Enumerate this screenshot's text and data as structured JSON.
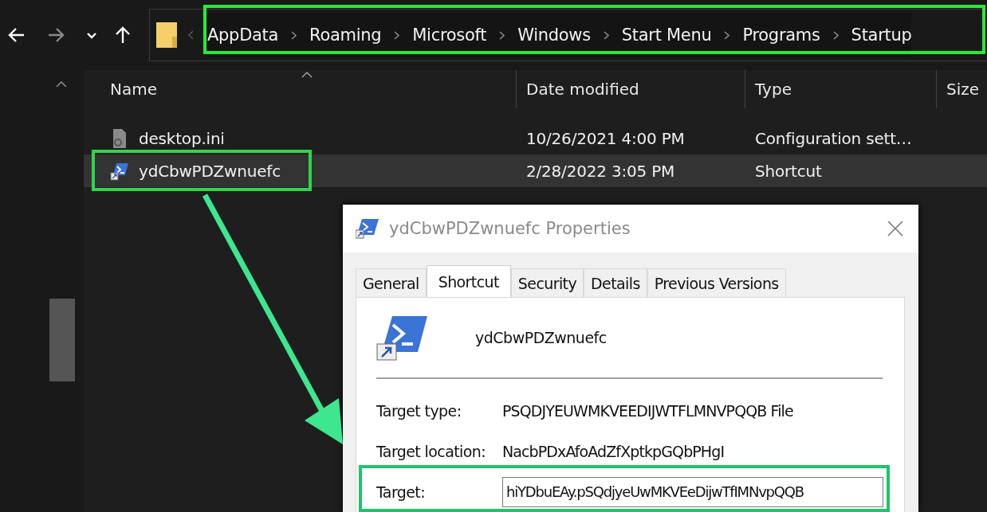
{
  "breadcrumb": [
    "AppData",
    "Roaming",
    "Microsoft",
    "Windows",
    "Start Menu",
    "Programs",
    "Startup"
  ],
  "columns": [
    "Name",
    "Date modified",
    "Type",
    "Size"
  ],
  "files": [
    {
      "name": "desktop.ini",
      "date": "10/26/2021 4:00 PM",
      "type": "Configuration sett…",
      "kind": "settings",
      "selected": false
    },
    {
      "name": "ydCbwPDZwnuefc",
      "date": "2/28/2022 3:05 PM",
      "type": "Shortcut",
      "kind": "shortcut",
      "selected": true
    }
  ],
  "dialog": {
    "title": "ydCbwPDZwnuefc Properties",
    "tabs": [
      {
        "label": "General",
        "selected": false
      },
      {
        "label": "Shortcut",
        "selected": true
      },
      {
        "label": "Security",
        "selected": false
      },
      {
        "label": "Details",
        "selected": false
      },
      {
        "label": "Previous Versions",
        "selected": false
      }
    ],
    "file_name": "ydCbwPDZwnuefc",
    "fields": [
      {
        "label": "Target type:",
        "value": "PSQDJYEUWMKVEEDIJWTFLMNVPQQB File",
        "kind": "text"
      },
      {
        "label": "Target location:",
        "value": "NacbPDxAfoAdZfXptkpGQbPHgI",
        "kind": "text"
      },
      {
        "label": "Target:",
        "value": "hiYDbuEAy.pSQdjyeUwMKVEeDijwTfIMNvpQQB",
        "kind": "input"
      }
    ]
  }
}
